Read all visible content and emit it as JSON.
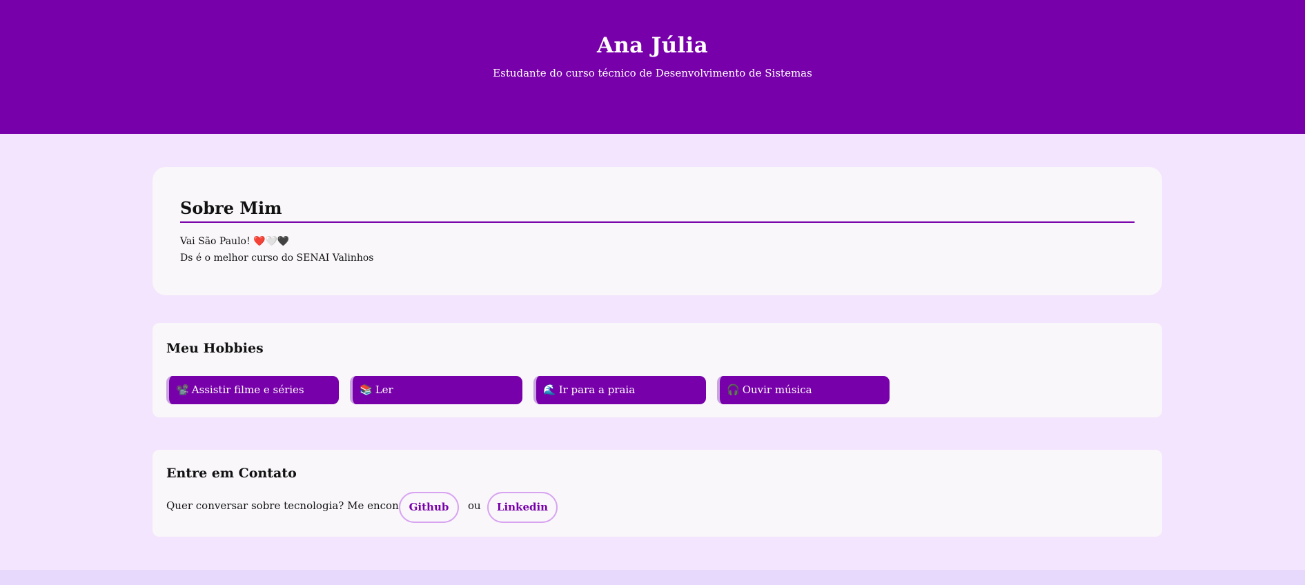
{
  "header": {
    "title": "Ana Júlia",
    "subtitle": "Estudante do curso técnico de Desenvolvimento de Sistemas"
  },
  "about": {
    "title": "Sobre Mim",
    "lines": [
      "Vai São Paulo! ❤️🤍🖤",
      "Ds é o melhor curso do SENAI Valinhos"
    ]
  },
  "hobbies": {
    "title": "Meu Hobbies",
    "items": [
      {
        "icon": "📽️",
        "label": "Assistir filme e séries"
      },
      {
        "icon": "📚",
        "label": "Ler"
      },
      {
        "icon": "🌊",
        "label": "Ir para a praia"
      },
      {
        "icon": "🎧",
        "label": "Ouvir música"
      }
    ]
  },
  "contact": {
    "title": "Entre em Contato",
    "text": "Quer conversar sobre tecnologia? Me encontre no",
    "github_label": "Github",
    "or_text": "ou",
    "linkedin_label": "Linkedin"
  },
  "colors": {
    "header_bg": "#7800aa",
    "page_bg": "#f3e5fd",
    "card_bg": "#f9f7fa",
    "pill_border": "#d8a4f2",
    "footer_bg": "#e7d9fb"
  }
}
